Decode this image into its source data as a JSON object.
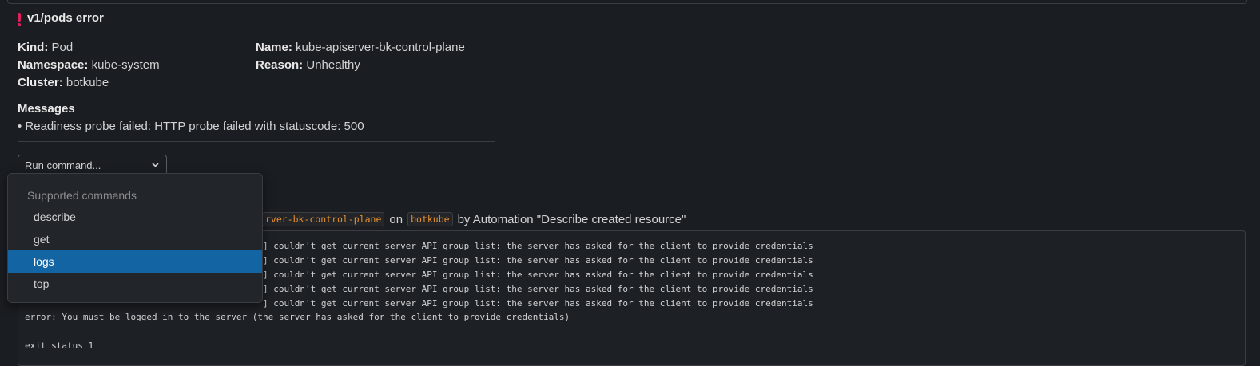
{
  "alert": {
    "title": "v1/pods error",
    "fields": {
      "kind": {
        "label": "Kind:",
        "value": "Pod"
      },
      "namespace": {
        "label": "Namespace:",
        "value": "kube-system"
      },
      "cluster": {
        "label": "Cluster:",
        "value": "botkube"
      },
      "name": {
        "label": "Name:",
        "value": "kube-apiserver-bk-control-plane"
      },
      "reason": {
        "label": "Reason:",
        "value": "Unhealthy"
      }
    },
    "messages_title": "Messages",
    "messages": [
      "• Readiness probe failed: HTTP probe failed with statuscode: 500"
    ]
  },
  "run_command": {
    "placeholder": "Run command...",
    "dropdown": {
      "header": "Supported commands",
      "items": [
        "describe",
        "get",
        "logs",
        "top"
      ],
      "selected": "logs"
    }
  },
  "result": {
    "resource_tag": "rver-bk-control-plane",
    "on_text": "on",
    "cluster_tag": "botkube",
    "by_text": "by Automation \"Describe created resource\""
  },
  "output": {
    "lines": [
      "] couldn't get current server API group list: the server has asked for the client to provide credentials",
      "] couldn't get current server API group list: the server has asked for the client to provide credentials",
      "] couldn't get current server API group list: the server has asked for the client to provide credentials",
      "] couldn't get current server API group list: the server has asked for the client to provide credentials",
      "] couldn't get current server API group list: the server has asked for the client to provide credentials"
    ],
    "error_line": "error: You must be logged in to the server (the server has asked for the client to provide credentials)",
    "exit_line": "exit status 1"
  },
  "colors": {
    "background": "#1a1d21",
    "error_icon": "#e01e5a",
    "tag_text": "#e8912d",
    "selected_item": "#1264a3"
  }
}
